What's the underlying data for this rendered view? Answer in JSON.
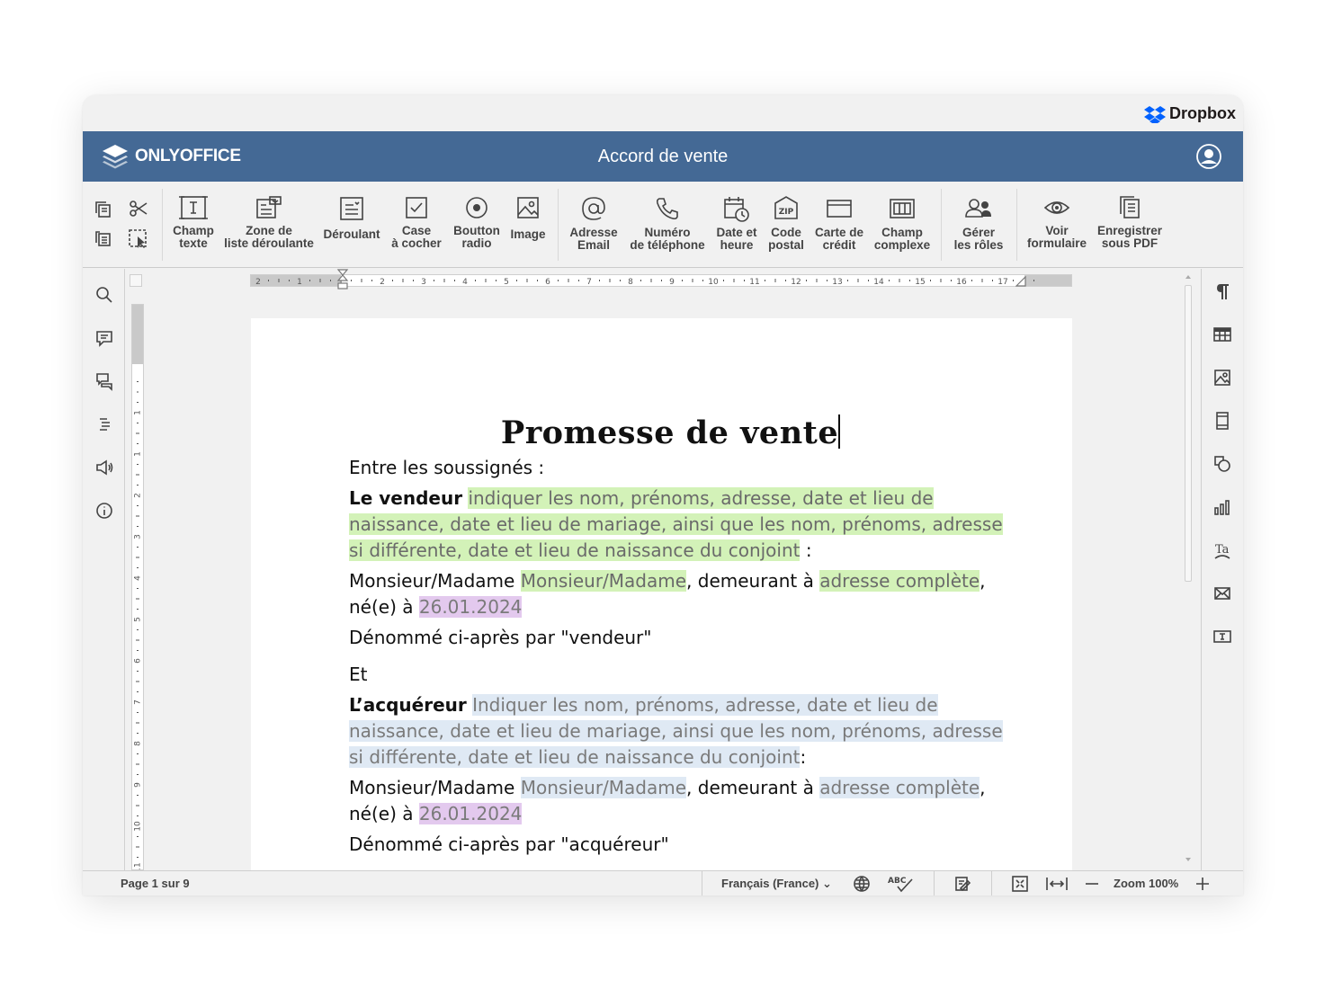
{
  "brand": {
    "cloud_label": "Dropbox",
    "app_name": "ONLYOFFICE"
  },
  "header": {
    "doc_title": "Accord de vente"
  },
  "toolbar": {
    "items": [
      {
        "label": "Champ\ntexte"
      },
      {
        "label": "Zone de\nliste déroulante"
      },
      {
        "label": "Déroulant"
      },
      {
        "label": "Case\nà cocher"
      },
      {
        "label": "Boutton\nradio"
      },
      {
        "label": "Image"
      },
      {
        "label": "Adresse\nEmail"
      },
      {
        "label": "Numéro\nde téléphone"
      },
      {
        "label": "Date et\nheure"
      },
      {
        "label": "Code\npostal"
      },
      {
        "label": "Carte de\ncrédit"
      },
      {
        "label": "Champ\ncomplexe"
      },
      {
        "label": "Gérer\nles rôles"
      },
      {
        "label": "Voir\nformulaire"
      },
      {
        "label": "Enregistrer\nsous PDF"
      }
    ]
  },
  "document": {
    "title": "Promesse de vente",
    "intro": "Entre les soussignés :",
    "seller": {
      "label": "Le vendeur",
      "placeholder": "indiquer les nom, prénoms, adresse, date et lieu de naissance, date et lieu de mariage, ainsi que les nom, prénoms, adresse si différente, date et lieu de naissance du conjoint",
      "end": " :",
      "civ_prefix": "Monsieur/Madame ",
      "civ_field": "Monsieur/Madame",
      "addr_prefix": ", demeurant à ",
      "addr_field": "adresse complète",
      "born_prefix": "né(e) à ",
      "date_field": "26.01.2024",
      "named": "Dénommé ci-après par \"vendeur\""
    },
    "and": "Et",
    "buyer": {
      "label": "L’acquéreur",
      "placeholder": "Indiquer les nom, prénoms, adresse, date et lieu de naissance, date et lieu de mariage, ainsi que les nom, prénoms, adresse si différente, date et lieu de naissance du conjoint",
      "end": ":",
      "civ_prefix": "Monsieur/Madame ",
      "civ_field": "Monsieur/Madame",
      "addr_prefix": ", demeurant à ",
      "addr_field": "adresse complète",
      "born_prefix": "né(e) à ",
      "date_field": "26.01.2024",
      "named": "Dénommé ci-après par \"acquéreur\""
    }
  },
  "rulers": {
    "horizontal_ticks": [
      "2",
      "1",
      "1",
      "2",
      "3",
      "4",
      "5",
      "6",
      "7",
      "8",
      "9",
      "10",
      "11",
      "12",
      "13",
      "14",
      "15",
      "16",
      "17"
    ],
    "vertical_ticks": [
      "1",
      "1",
      "2",
      "3",
      "4",
      "5",
      "6",
      "7",
      "8",
      "9",
      "10",
      "11",
      "12"
    ]
  },
  "status": {
    "page": "Page 1 sur 9",
    "language": "Français  (France)",
    "zoom": "Zoom 100%"
  },
  "colors": {
    "header_bg": "#446995",
    "field_green": "#d3f2b8",
    "field_blue": "#dfe9f4",
    "field_date": "#e3c9ee"
  }
}
